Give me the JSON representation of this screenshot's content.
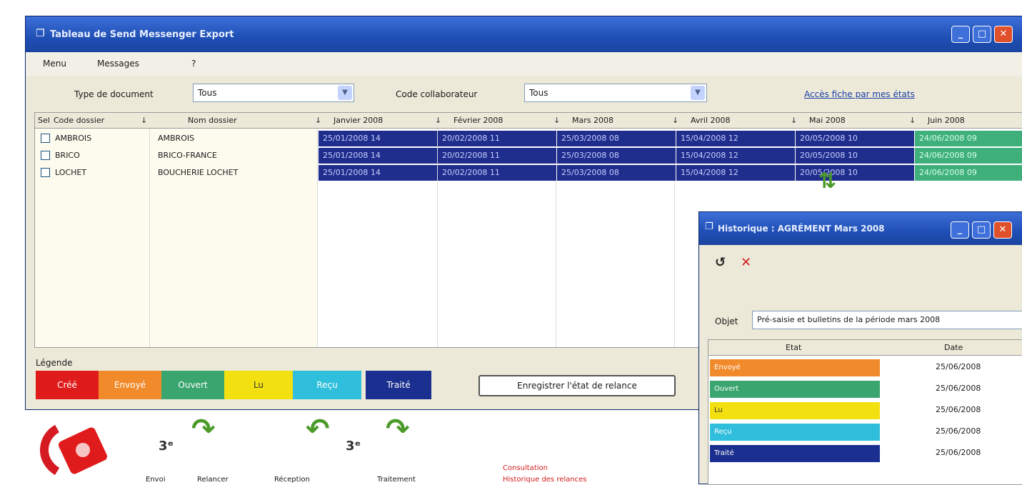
{
  "window": {
    "title": "Tableau de Send Messenger Export"
  },
  "menu": [
    "Menu",
    "Messages",
    "?"
  ],
  "filters": {
    "type_label": "Type de document",
    "type_value": "Tous",
    "code_label": "Code collaborateur",
    "code_value": "Tous",
    "link": "Accès fiche par mes états"
  },
  "grid": {
    "headers": [
      "Sel",
      "Code dossier",
      "Nom dossier",
      "Janvier 2008",
      "Février 2008",
      "Mars 2008",
      "Avril 2008",
      "Mai 2008",
      "Juin 2008"
    ],
    "rows": [
      {
        "code": "AMBROIS",
        "name": "AMBROIS",
        "months": [
          "25/01/2008 14",
          "20/02/2008 11",
          "25/03/2008 08",
          "15/04/2008 12",
          "20/05/2008 10",
          "24/06/2008 09"
        ]
      },
      {
        "code": "BRICO",
        "name": "BRICO-FRANCE",
        "months": [
          "25/01/2008 14",
          "20/02/2008 11",
          "25/03/2008 08",
          "15/04/2008 12",
          "20/05/2008 10",
          "24/06/2008 09"
        ]
      },
      {
        "code": "LOCHET",
        "name": "BOUCHERIE LOCHET",
        "months": [
          "25/01/2008 14",
          "20/02/2008 11",
          "25/03/2008 08",
          "15/04/2008 12",
          "20/05/2008 10",
          "24/06/2008 09"
        ]
      }
    ]
  },
  "legend": {
    "label": "Légende",
    "items": [
      {
        "label": "Créé",
        "color": "#e01b1b"
      },
      {
        "label": "Envoyé",
        "color": "#f08a2a"
      },
      {
        "label": "Ouvert",
        "color": "#3aa56e"
      },
      {
        "label": "Lu",
        "color": "#f3e010"
      },
      {
        "label": "Reçu",
        "color": "#2fbfdc"
      },
      {
        "label": "Traité",
        "color": "#1a2f8f"
      }
    ]
  },
  "save_button": "Enregistrer l'état de relance",
  "sub_window": {
    "title": "Historique : AGRÉMENT Mars 2008",
    "objet_label": "Objet",
    "objet_value": "Pré-saisie et bulletins de la période mars 2008",
    "headers": [
      "Etat",
      "Date"
    ],
    "rows": [
      {
        "etat": "Envoyé",
        "color": "#f08a2a",
        "date": "25/06/2008"
      },
      {
        "etat": "Ouvert",
        "color": "#3aa56e",
        "date": "25/06/2008"
      },
      {
        "etat": "Lu",
        "color": "#f3e010",
        "date": "25/06/2008"
      },
      {
        "etat": "Reçu",
        "color": "#2fbfdc",
        "date": "25/06/2008"
      },
      {
        "etat": "Traité",
        "color": "#1a2f8f",
        "date": "25/06/2008"
      }
    ]
  },
  "bottom_labels": [
    "Envoi",
    "Relancer",
    "Réception",
    "Traitement",
    "Consultation"
  ],
  "bottom_note": "Historique des relances",
  "colors": {
    "month_cell": "#1f2d8c",
    "june_cell": "#3fb07c"
  }
}
